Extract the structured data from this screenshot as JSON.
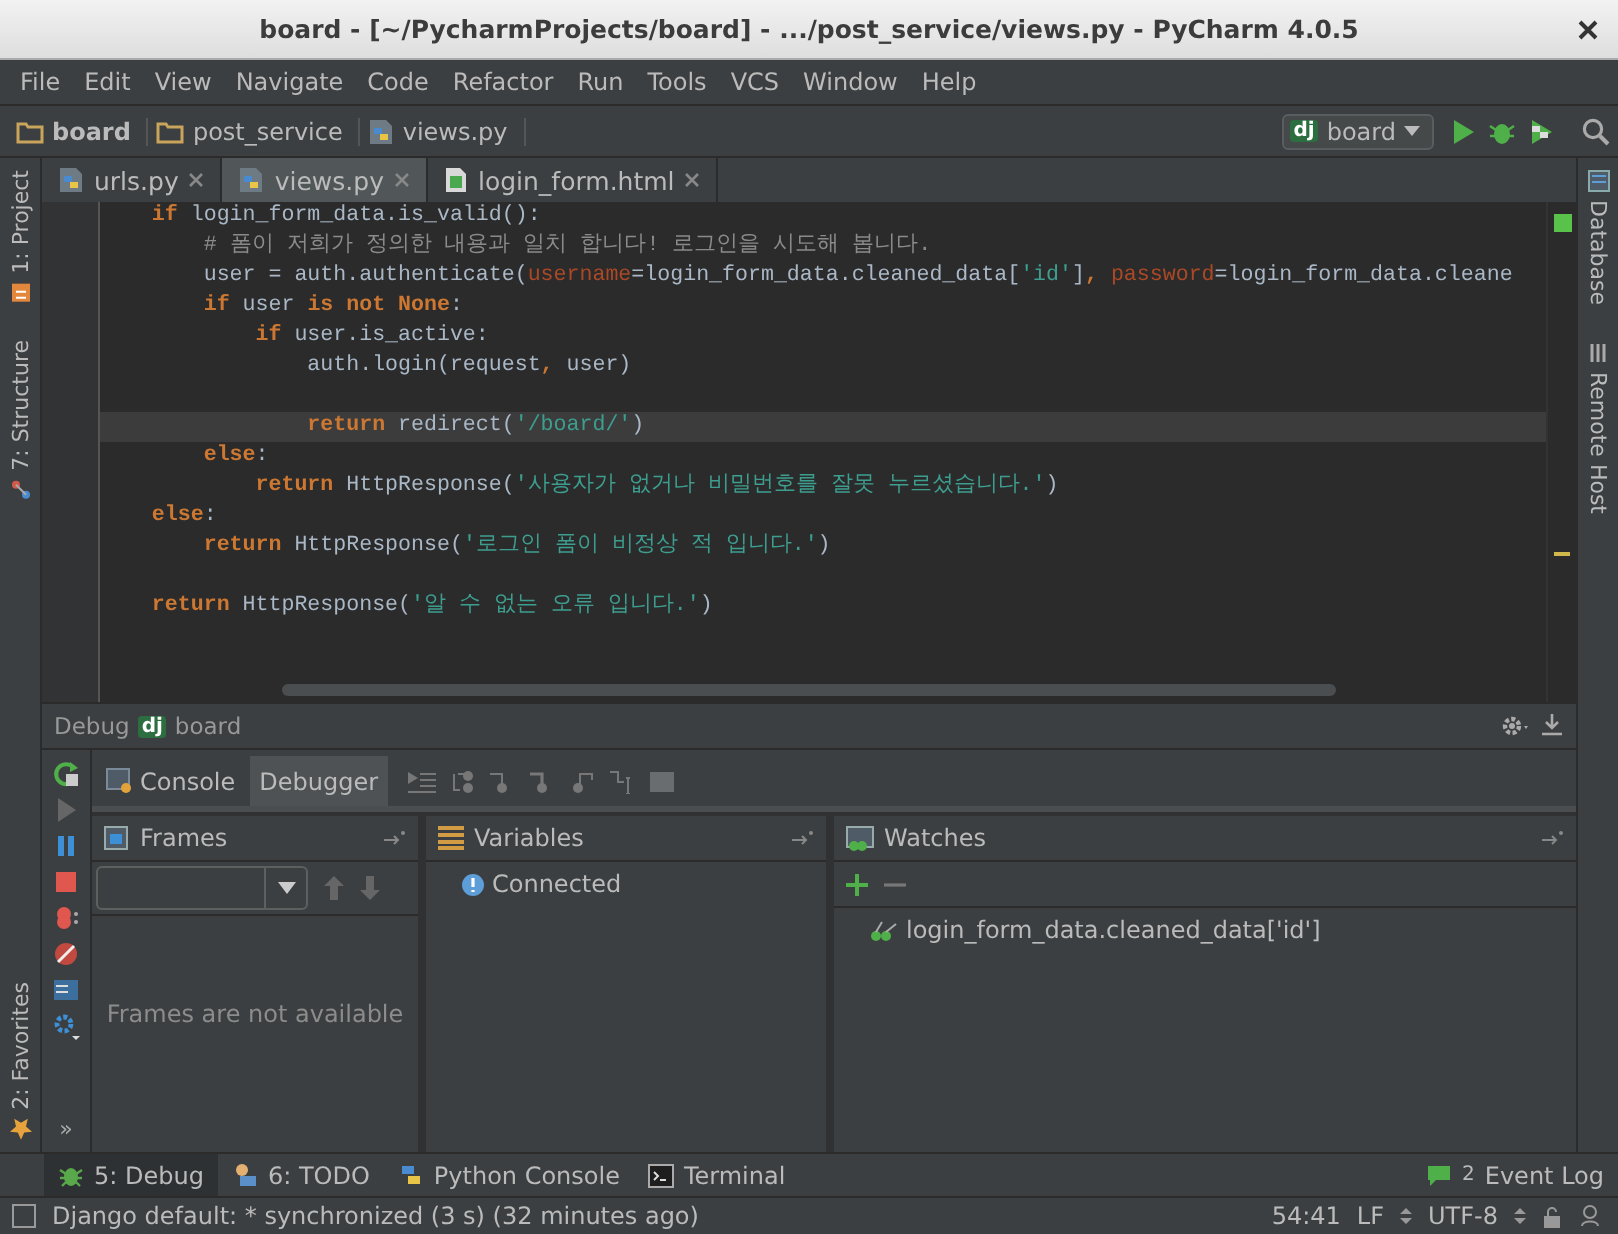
{
  "window": {
    "title": "board - [~/PycharmProjects/board] - .../post_service/views.py - PyCharm 4.0.5"
  },
  "menu": [
    "File",
    "Edit",
    "View",
    "Navigate",
    "Code",
    "Refactor",
    "Run",
    "Tools",
    "VCS",
    "Window",
    "Help"
  ],
  "breadcrumbs": [
    {
      "label": "board",
      "kind": "folder"
    },
    {
      "label": "post_service",
      "kind": "folder"
    },
    {
      "label": "views.py",
      "kind": "python"
    }
  ],
  "run_config": {
    "logo": "dj",
    "label": "board"
  },
  "left_strip": {
    "top": [
      "1: Project",
      "7: Structure"
    ],
    "bottom": [
      "2: Favorites"
    ]
  },
  "right_strip": [
    "Database",
    "Remote Host"
  ],
  "editor_tabs": [
    {
      "label": "urls.py",
      "kind": "python",
      "selected": false
    },
    {
      "label": "views.py",
      "kind": "python",
      "selected": true
    },
    {
      "label": "login_form.html",
      "kind": "html",
      "selected": false
    }
  ],
  "code_lines": [
    {
      "current": false,
      "tokens": [
        {
          "kind": "kw",
          "text": "    if"
        },
        {
          "kind": "plain",
          "text": " login_form_data.is_valid():"
        }
      ]
    },
    {
      "current": false,
      "tokens": [
        {
          "kind": "comment",
          "text": "        # 폼이 저희가 정의한 내용과 일치 합니다! 로그인을 시도해 봅니다."
        }
      ]
    },
    {
      "current": false,
      "tokens": [
        {
          "kind": "plain",
          "text": "        user = auth.authenticate("
        },
        {
          "kind": "param",
          "text": "username"
        },
        {
          "kind": "plain",
          "text": "=login_form_data.cleaned_data["
        },
        {
          "kind": "str",
          "text": "'id'"
        },
        {
          "kind": "plain",
          "text": "]"
        },
        {
          "kind": "kw",
          "text": ", "
        },
        {
          "kind": "param",
          "text": "password"
        },
        {
          "kind": "plain",
          "text": "=login_form_data.cleane"
        }
      ]
    },
    {
      "current": false,
      "tokens": [
        {
          "kind": "kw",
          "text": "        if"
        },
        {
          "kind": "plain",
          "text": " user "
        },
        {
          "kind": "kw",
          "text": "is not None"
        },
        {
          "kind": "plain",
          "text": ":"
        }
      ]
    },
    {
      "current": false,
      "tokens": [
        {
          "kind": "kw",
          "text": "            if"
        },
        {
          "kind": "plain",
          "text": " user.is_active:"
        }
      ]
    },
    {
      "current": false,
      "tokens": [
        {
          "kind": "plain",
          "text": "                auth.login(request"
        },
        {
          "kind": "kw",
          "text": ","
        },
        {
          "kind": "plain",
          "text": " user)"
        }
      ]
    },
    {
      "current": false
    },
    {
      "current": true,
      "tokens": [
        {
          "kind": "kw",
          "text": "                return"
        },
        {
          "kind": "plain",
          "text": " redirect("
        },
        {
          "kind": "str",
          "text": "'/board/'"
        },
        {
          "kind": "plain",
          "text": ")"
        }
      ]
    },
    {
      "current": false,
      "tokens": [
        {
          "kind": "kw",
          "text": "        else"
        },
        {
          "kind": "plain",
          "text": ":"
        }
      ]
    },
    {
      "current": false,
      "tokens": [
        {
          "kind": "kw",
          "text": "            return"
        },
        {
          "kind": "plain",
          "text": " HttpResponse("
        },
        {
          "kind": "str",
          "text": "'사용자가 없거나 비밀번호를 잘못 누르셨습니다.'"
        },
        {
          "kind": "plain",
          "text": ")"
        }
      ]
    },
    {
      "current": false,
      "tokens": [
        {
          "kind": "kw",
          "text": "    else"
        },
        {
          "kind": "plain",
          "text": ":"
        }
      ]
    },
    {
      "current": false,
      "tokens": [
        {
          "kind": "kw",
          "text": "        return"
        },
        {
          "kind": "plain",
          "text": " HttpResponse("
        },
        {
          "kind": "str",
          "text": "'로그인 폼이 비정상 적 입니다.'"
        },
        {
          "kind": "plain",
          "text": ")"
        }
      ]
    },
    {
      "current": false
    },
    {
      "current": false,
      "tokens": [
        {
          "kind": "kw",
          "text": "    return"
        },
        {
          "kind": "plain",
          "text": " HttpResponse("
        },
        {
          "kind": "str",
          "text": "'알 수 없는 오류 입니다.'"
        },
        {
          "kind": "plain",
          "text": ")"
        }
      ]
    }
  ],
  "debug": {
    "title": "Debug",
    "logo": "dj",
    "config": "board",
    "tabs": [
      {
        "label": "Console",
        "selected": false
      },
      {
        "label": "Debugger",
        "selected": true
      }
    ],
    "more": "»",
    "frames": {
      "title": "Frames",
      "empty_text": "Frames are not available"
    },
    "variables": {
      "title": "Variables",
      "items": [
        "Connected"
      ]
    },
    "watches": {
      "title": "Watches",
      "items": [
        "login_form_data.cleaned_data['id']"
      ]
    }
  },
  "tool_buttons": [
    {
      "label": "5: Debug",
      "kind": "debug",
      "selected": true
    },
    {
      "label": "6: TODO",
      "kind": "todo",
      "selected": false
    },
    {
      "label": "Python Console",
      "kind": "python",
      "selected": false
    },
    {
      "label": "Terminal",
      "kind": "terminal",
      "selected": false
    }
  ],
  "event_log": {
    "badge": "2",
    "label": "Event Log"
  },
  "status_bar": {
    "message": "Django default: * synchronized (3 s) (32 minutes ago)",
    "position": "54:41",
    "line_separator": "LF",
    "encoding": "UTF-8"
  }
}
